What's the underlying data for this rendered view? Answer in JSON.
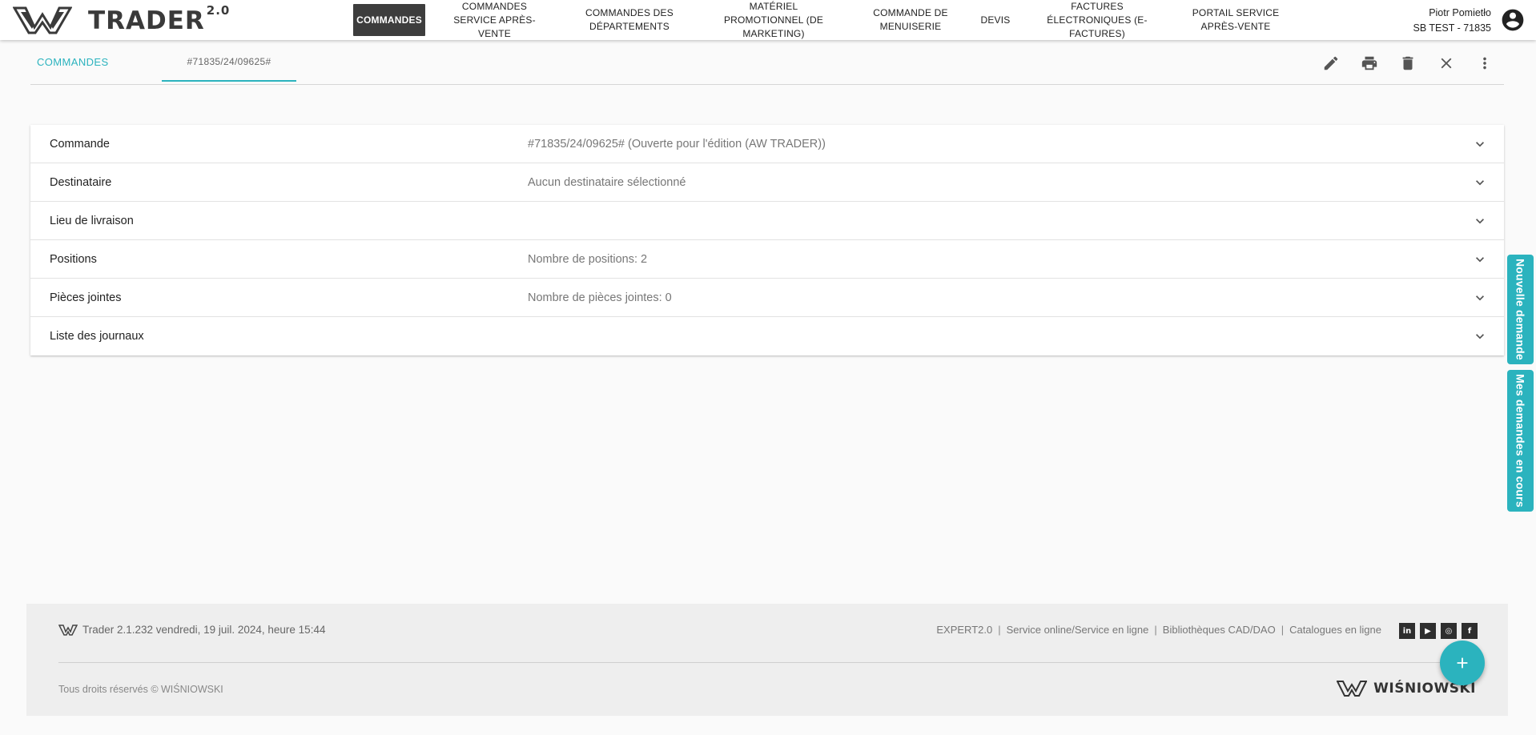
{
  "app": {
    "logo_text": "TRADER",
    "logo_version": "2.0"
  },
  "nav": {
    "items": [
      {
        "label": "COMMANDES"
      },
      {
        "label": "COMMANDES SERVICE APRÈS-VENTE"
      },
      {
        "label": "COMMANDES DES DÉPARTEMENTS"
      },
      {
        "label": "MATÉRIEL PROMOTIONNEL (DE MARKETING)"
      },
      {
        "label": "COMMANDE DE MENUISERIE"
      },
      {
        "label": "DEVIS"
      },
      {
        "label": "FACTURES ÉLECTRONIQUES (E-FACTURES)"
      },
      {
        "label": "PORTAIL SERVICE APRÈS-VENTE"
      }
    ]
  },
  "user": {
    "name": "Piotr Pomietło",
    "company": "SB TEST - 71835"
  },
  "tabs": {
    "home": "COMMANDES",
    "order": "#71835/24/09625#"
  },
  "toolbar": {
    "edit": "pencil-icon",
    "print": "printer-icon",
    "delete": "trash-icon",
    "close": "close-icon",
    "more": "more-vert-icon"
  },
  "sections": [
    {
      "label": "Commande",
      "value": "#71835/24/09625# (Ouverte pour l'édition (AW TRADER))"
    },
    {
      "label": "Destinataire",
      "value": "Aucun destinataire sélectionné"
    },
    {
      "label": "Lieu de livraison",
      "value": ""
    },
    {
      "label": "Positions",
      "value": "Nombre de positions: 2"
    },
    {
      "label": "Pièces jointes",
      "value": "Nombre de pièces jointes: 0"
    },
    {
      "label": "Liste des journaux",
      "value": ""
    }
  ],
  "side_tabs": {
    "new_request": "Nouvelle demande",
    "my_requests": "Mes demandes en cours"
  },
  "footer": {
    "version": "Trader 2.1.232 vendredi, 19 juil. 2024, heure 15:44",
    "links": [
      "EXPERT2.0",
      "Service online/Service en ligne",
      "Bibliothèques CAD/DAO",
      "Catalogues en ligne"
    ],
    "social": [
      "in",
      "▶",
      "◎",
      "f"
    ],
    "copyright": "Tous droits réservés © WIŚNIOWSKI",
    "brand": "WIŚNIOWSKI"
  },
  "colors": {
    "accent": "#2bb3be",
    "nav_active": "#3d3d3d"
  }
}
